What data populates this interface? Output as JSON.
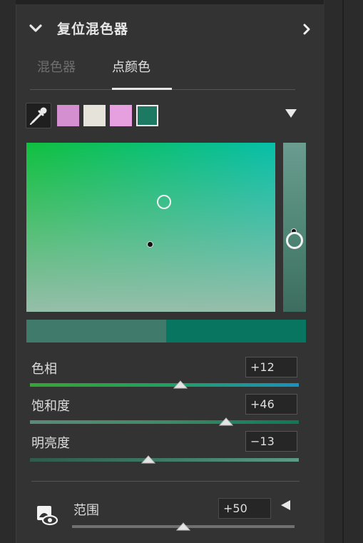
{
  "header": {
    "title": "复位混色器"
  },
  "tabs": [
    {
      "label": "混色器",
      "active": false
    },
    {
      "label": "点颜色",
      "active": true
    }
  ],
  "swatches": [
    {
      "color": "#d48fd0"
    },
    {
      "color": "#e6e4da"
    },
    {
      "color": "#e6a0e0"
    },
    {
      "color": "#1c7a63",
      "selected": true
    }
  ],
  "compare": {
    "original_color": "#3f7a6a",
    "adjusted_color": "#077560"
  },
  "sliders": [
    {
      "label": "色相",
      "value": "+12",
      "level": 0.56
    },
    {
      "label": "饱和度",
      "value": "+46",
      "level": 0.73
    },
    {
      "label": "明亮度",
      "value": "−13",
      "level": 0.44
    }
  ],
  "range": {
    "label": "范围",
    "value": "+50",
    "level": 0.5
  }
}
